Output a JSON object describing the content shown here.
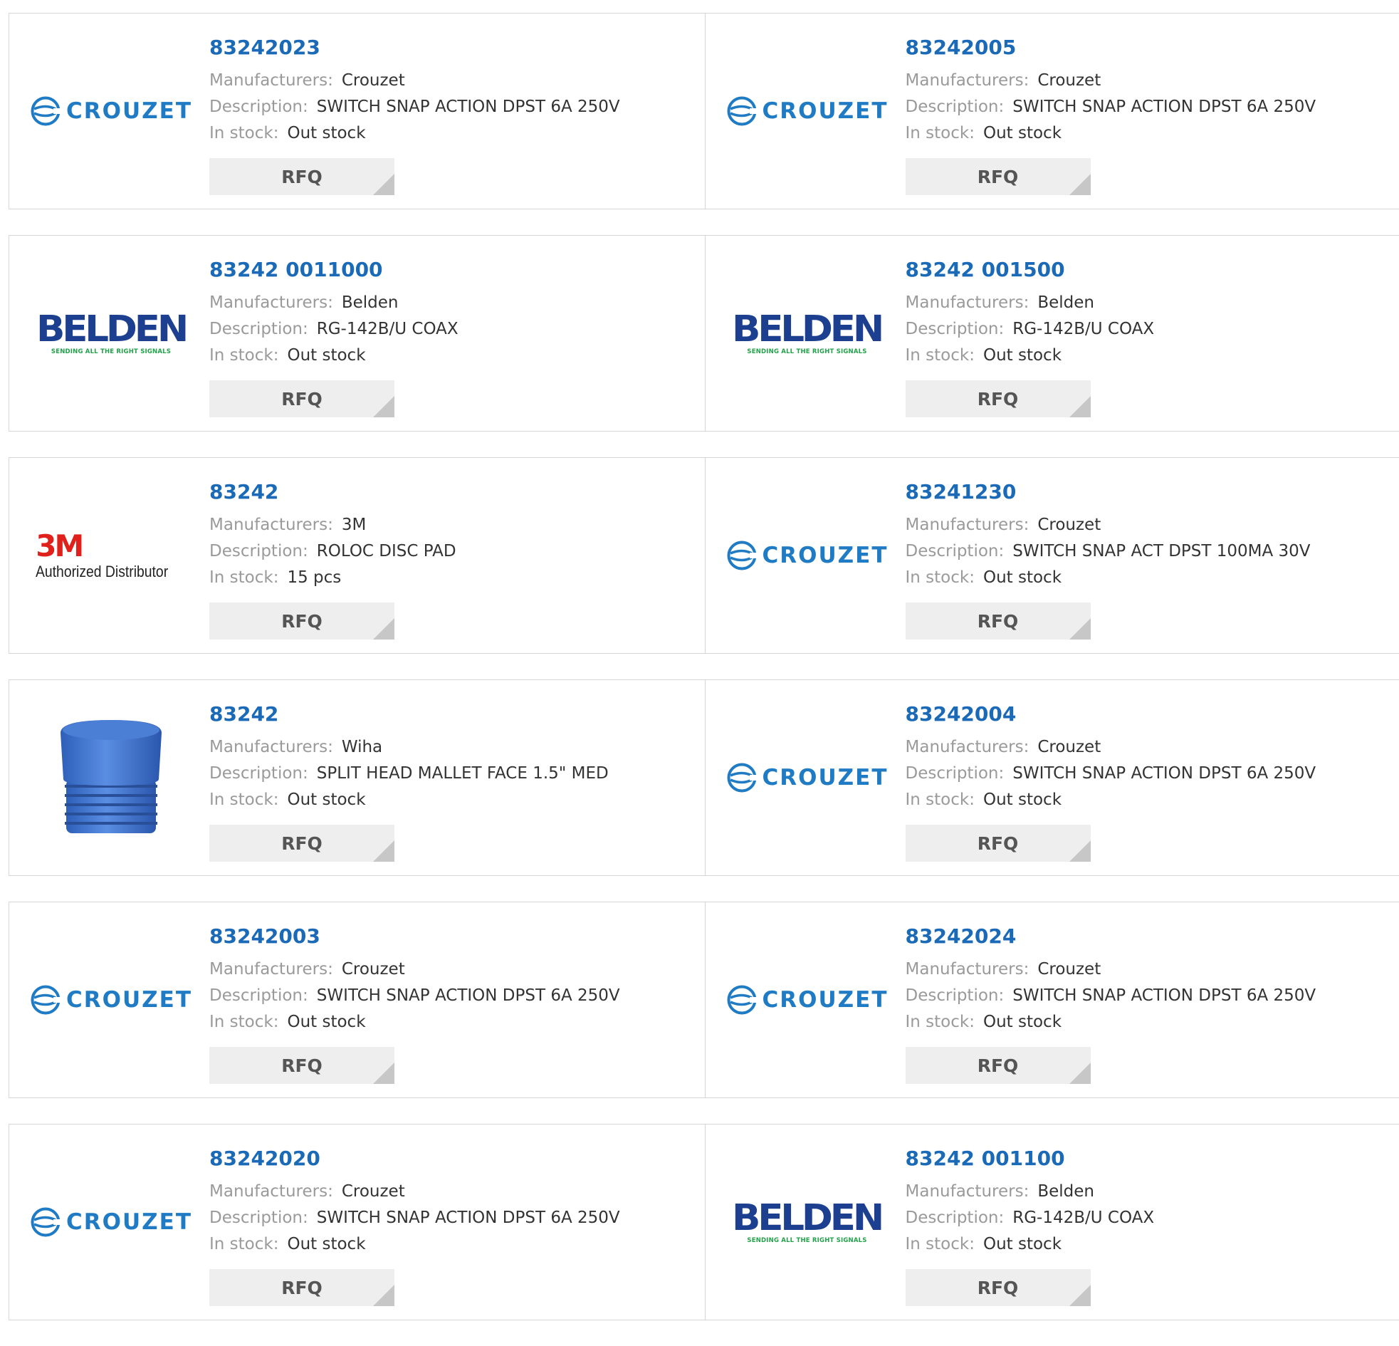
{
  "labels": {
    "manufacturers": "Manufacturers:",
    "description": "Description:",
    "in_stock": "In stock:",
    "rfq": "RFQ"
  },
  "logos": {
    "crouzet_text": "CROUZET",
    "belden_text": "BELDEN",
    "belden_tagline": "SENDING ALL THE RIGHT SIGNALS",
    "threem_text": "3M",
    "threem_tagline": "Authorized Distributor"
  },
  "colors": {
    "part_link": "#1a6ab8",
    "label": "#9a9a9a",
    "value": "#333333",
    "rfq_bg": "#eeeeee",
    "crouzet_blue": "#1f7bc4",
    "belden_navy": "#1c3f8f",
    "belden_green": "#22a24a",
    "threem_red": "#e0201b"
  },
  "products": [
    {
      "part": "83242023",
      "manufacturer": "Crouzet",
      "description": "SWITCH SNAP ACTION DPST 6A 250V",
      "stock": "Out stock",
      "logo": "crouzet-logo"
    },
    {
      "part": "83242005",
      "manufacturer": "Crouzet",
      "description": "SWITCH SNAP ACTION DPST 6A 250V",
      "stock": "Out stock",
      "logo": "crouzet-logo"
    },
    {
      "part": "83242 0011000",
      "manufacturer": "Belden",
      "description": "RG-142B/U COAX",
      "stock": "Out stock",
      "logo": "belden-logo"
    },
    {
      "part": "83242 001500",
      "manufacturer": "Belden",
      "description": "RG-142B/U COAX",
      "stock": "Out stock",
      "logo": "belden-logo"
    },
    {
      "part": "83242",
      "manufacturer": "3M",
      "description": "ROLOC DISC PAD",
      "stock": "15 pcs",
      "logo": "3m-authorized-distributor-logo"
    },
    {
      "part": "83241230",
      "manufacturer": "Crouzet",
      "description": "SWITCH SNAP ACT DPST 100MA 30V",
      "stock": "Out stock",
      "logo": "crouzet-logo"
    },
    {
      "part": "83242",
      "manufacturer": "Wiha",
      "description": "SPLIT HEAD MALLET FACE 1.5\" MED",
      "stock": "Out stock",
      "logo": "mallet-face-product-image"
    },
    {
      "part": "83242004",
      "manufacturer": "Crouzet",
      "description": "SWITCH SNAP ACTION DPST 6A 250V",
      "stock": "Out stock",
      "logo": "crouzet-logo"
    },
    {
      "part": "83242003",
      "manufacturer": "Crouzet",
      "description": "SWITCH SNAP ACTION DPST 6A 250V",
      "stock": "Out stock",
      "logo": "crouzet-logo"
    },
    {
      "part": "83242024",
      "manufacturer": "Crouzet",
      "description": "SWITCH SNAP ACTION DPST 6A 250V",
      "stock": "Out stock",
      "logo": "crouzet-logo"
    },
    {
      "part": "83242020",
      "manufacturer": "Crouzet",
      "description": "SWITCH SNAP ACTION DPST 6A 250V",
      "stock": "Out stock",
      "logo": "crouzet-logo"
    },
    {
      "part": "83242 001100",
      "manufacturer": "Belden",
      "description": "RG-142B/U COAX",
      "stock": "Out stock",
      "logo": "belden-logo"
    }
  ]
}
